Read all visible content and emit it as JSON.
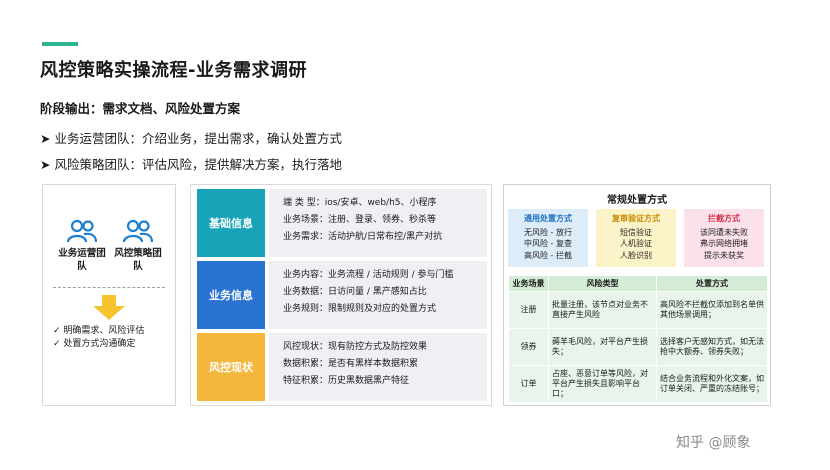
{
  "title": "风控策略实操流程-业务需求调研",
  "stage_output": "阶段输出：需求文档、风险处置方案",
  "bullets": [
    "业务运营团队：介绍业务，提出需求，确认处置方式",
    "风险策略团队：评估风险，提供解决方案，执行落地"
  ],
  "left_panel": {
    "team_a": "业务运营团队",
    "team_b": "风控策略团队",
    "check1": "明确需求、风险评估",
    "check2": "处置方式沟通确定"
  },
  "mid_panel": {
    "rows": [
      {
        "tag": "基础信息",
        "lines": [
          "端 类 型：ios/安卓、web/h5、小程序",
          "业务场景：注册、登录、领券、秒杀等",
          "业务需求：活动护航/日常布控/黑产对抗"
        ]
      },
      {
        "tag": "业务信息",
        "lines": [
          "业务内容：业务流程 / 活动规则 / 参与门槛",
          "业务数据：日访问量 / 黑产感知占比",
          "业务规则：限制规则及对应的处置方式"
        ]
      },
      {
        "tag": "风控现状",
        "lines": [
          "风控现状：现有防控方式及防控效果",
          "数据积累：是否有黑样本数据积累",
          "特征积累：历史黑数据黑产特征"
        ]
      }
    ]
  },
  "right_panel": {
    "title": "常规处置方式",
    "cards": [
      {
        "title": "通用处置方式",
        "lines": [
          "无风险 - 放行",
          "中风险 - 复查",
          "高风险 - 拦截"
        ]
      },
      {
        "title": "复审验证方式",
        "lines": [
          "短信验证",
          "人机验证",
          "人脸识别"
        ]
      },
      {
        "title": "拦截方式",
        "lines": [
          "该同遭未失败",
          "弗示网络拥堵",
          "提示未获奖"
        ]
      }
    ],
    "table": {
      "headers": [
        "业务场景",
        "风险类型",
        "处置方式"
      ],
      "rows": [
        [
          "注册",
          "批量注册，该节点对业务不直接产生风险",
          "高风险不拦截仅添加到名单供其他场景调用；"
        ],
        [
          "领券",
          "薅羊毛风险，对平台产生损失；",
          "选择客户无感知方式，如无法抢中大额券、领券失败；"
        ],
        [
          "订单",
          "占座、恶意订单等风险，对平台产生损失且影响平台口；",
          "结合业务流程和外化文案，如订单关闭、严重的冻结账号；"
        ]
      ]
    }
  },
  "watermark": "知乎 @顾象",
  "colors": {
    "accent": "#2db58f",
    "tag1": "#18a4b8",
    "tag2": "#2a73d0",
    "tag3": "#f4b63c"
  }
}
